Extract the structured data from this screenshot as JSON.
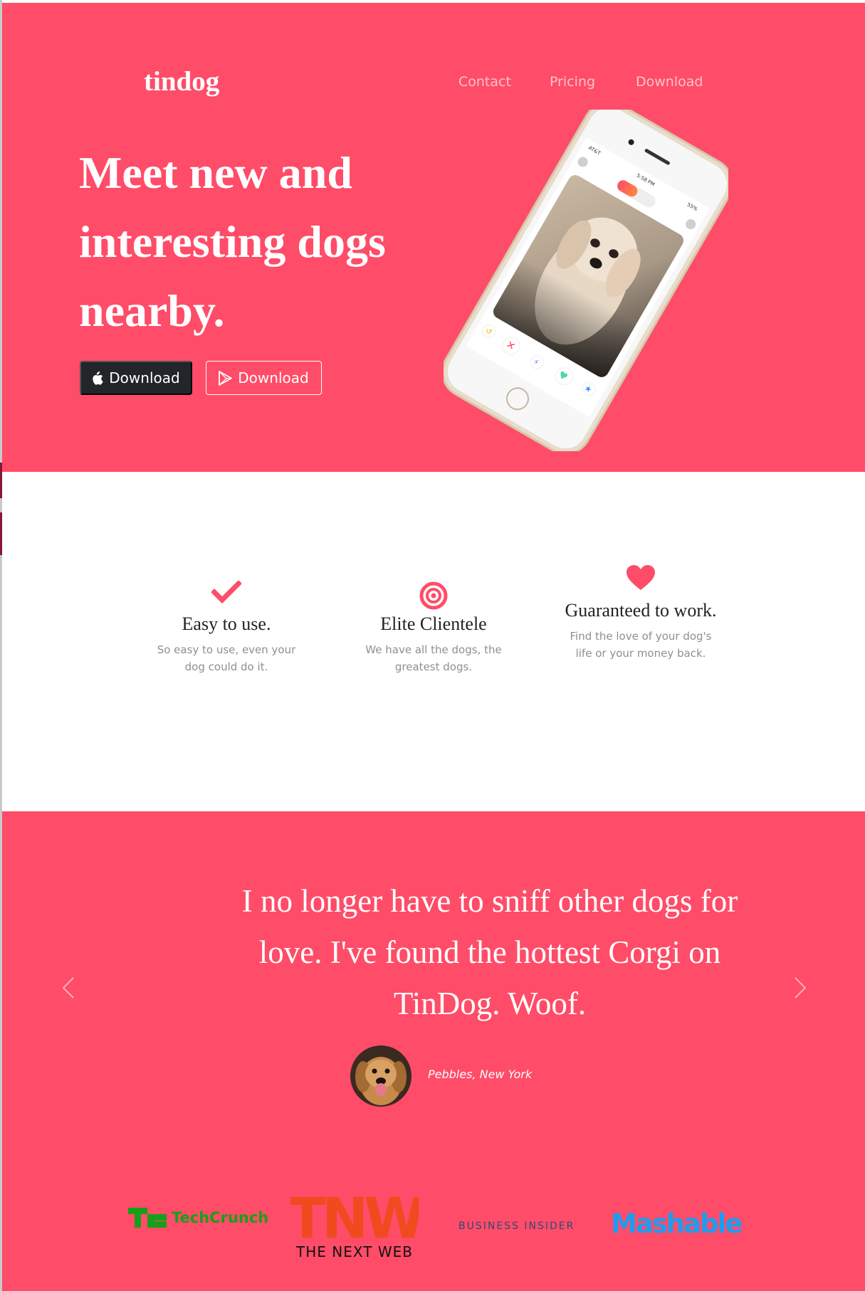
{
  "brand": "tindog",
  "nav": {
    "items": [
      "Contact",
      "Pricing",
      "Download"
    ]
  },
  "hero": {
    "headline_lines": [
      "Meet new and",
      "interesting dogs",
      "nearby."
    ],
    "apple_button": "Download",
    "play_button": "Download"
  },
  "phone": {
    "time": "5:58 PM",
    "carrier": "AT&T",
    "battery": "55%"
  },
  "features": [
    {
      "icon": "check-icon",
      "title": "Easy to use.",
      "text": "So easy to use, even your dog could do it."
    },
    {
      "icon": "bullseye-icon",
      "title": "Elite Clientele",
      "text": "We have all the dogs, the greatest dogs."
    },
    {
      "icon": "heart-icon",
      "title": "Guaranteed to work.",
      "text": "Find the love of your dog's life or your money back."
    }
  ],
  "testimonial": {
    "quote": "I no longer have to sniff other dogs for love. I've found the hottest Corgi on TinDog. Woof.",
    "author": "Pebbles, New York"
  },
  "press": {
    "techcrunch": "TechCrunch",
    "tnw": "TNW",
    "tnw_sub": "THE NEXT WEB",
    "business_insider": "BUSINESS INSIDER",
    "mashable": "Mashable"
  },
  "colors": {
    "brand": "#ff4c68",
    "dark_button": "#222529",
    "muted_text": "#8f8f8f"
  }
}
